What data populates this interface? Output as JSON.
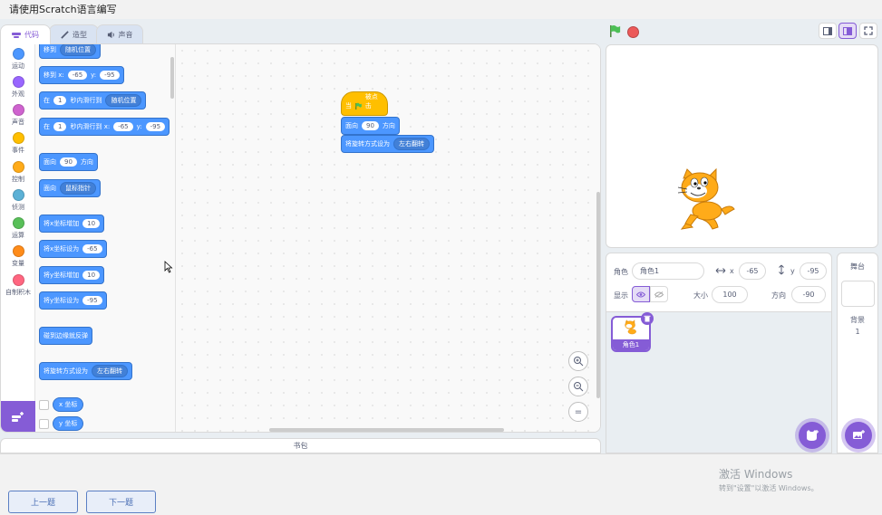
{
  "window": {
    "title": "请使用Scratch语言编写"
  },
  "tabs": [
    {
      "label": "代码",
      "icon": "code-icon",
      "active": true
    },
    {
      "label": "造型",
      "icon": "brush-icon",
      "active": false
    },
    {
      "label": "声音",
      "icon": "speaker-icon",
      "active": false
    }
  ],
  "categories": [
    {
      "label": "运动",
      "color": "#4c97ff"
    },
    {
      "label": "外观",
      "color": "#9966ff"
    },
    {
      "label": "声音",
      "color": "#cf63cf"
    },
    {
      "label": "事件",
      "color": "#ffbf00"
    },
    {
      "label": "控制",
      "color": "#ffab19"
    },
    {
      "label": "侦测",
      "color": "#5cb1d6"
    },
    {
      "label": "运算",
      "color": "#59c059"
    },
    {
      "label": "变量",
      "color": "#ff8c1a"
    },
    {
      "label": "自制积木",
      "color": "#ff6680"
    }
  ],
  "palette": {
    "goto": {
      "label": "移到",
      "dropdown": "随机位置"
    },
    "gotoxy": {
      "label": "移到 x:",
      "x": "-65",
      "ylabel": "y:",
      "y": "-95"
    },
    "glide": {
      "pre": "在",
      "secs": "1",
      "mid": "秒内滑行到",
      "dropdown": "随机位置"
    },
    "glidexy": {
      "pre": "在",
      "secs": "1",
      "mid": "秒内滑行到 x:",
      "x": "-65",
      "ylabel": "y:",
      "y": "-95"
    },
    "point": {
      "label": "面向",
      "value": "90",
      "suffix": "方向"
    },
    "pointtowards": {
      "label": "面向",
      "dropdown": "鼠标指针"
    },
    "changex": {
      "label": "将x坐标增加",
      "value": "10"
    },
    "setx": {
      "label": "将x坐标设为",
      "value": "-65"
    },
    "changey": {
      "label": "将y坐标增加",
      "value": "10"
    },
    "sety": {
      "label": "将y坐标设为",
      "value": "-95"
    },
    "bounce": {
      "label": "碰到边缘就反弹"
    },
    "rotstyle": {
      "label": "将旋转方式设为",
      "dropdown": "左右翻转"
    },
    "xpos": {
      "label": "x 坐标"
    },
    "ypos": {
      "label": "y 坐标"
    }
  },
  "script": {
    "hat": {
      "pre": "当",
      "post": "被点击"
    },
    "point": {
      "label": "面向",
      "value": "90",
      "suffix": "方向"
    },
    "rotstyle": {
      "label": "将旋转方式设为",
      "dropdown": "左右翻转"
    }
  },
  "zoom": {
    "in": "zoom-in-icon",
    "out": "zoom-out-icon",
    "reset": "="
  },
  "backpack": {
    "label": "书包"
  },
  "sprite_info": {
    "sprite_label": "角色",
    "sprite_name": "角色1",
    "x_label": "x",
    "x": "-65",
    "y_label": "y",
    "y": "-95",
    "show_label": "显示",
    "size_label": "大小",
    "size": "100",
    "direction_label": "方向",
    "direction": "-90"
  },
  "sprites": [
    {
      "name": "角色1",
      "selected": true
    }
  ],
  "stage_pane": {
    "title": "舞台",
    "backdrop_label": "背景",
    "backdrop_count": "1"
  },
  "bottom": {
    "prev": "上一题",
    "next": "下一题"
  },
  "watermark": {
    "line1": "激活 Windows",
    "line2": "转到\"设置\"以激活 Windows。"
  },
  "colors": {
    "motion": "#4c97ff",
    "events": "#ffbf00",
    "accent": "#855cd6"
  }
}
